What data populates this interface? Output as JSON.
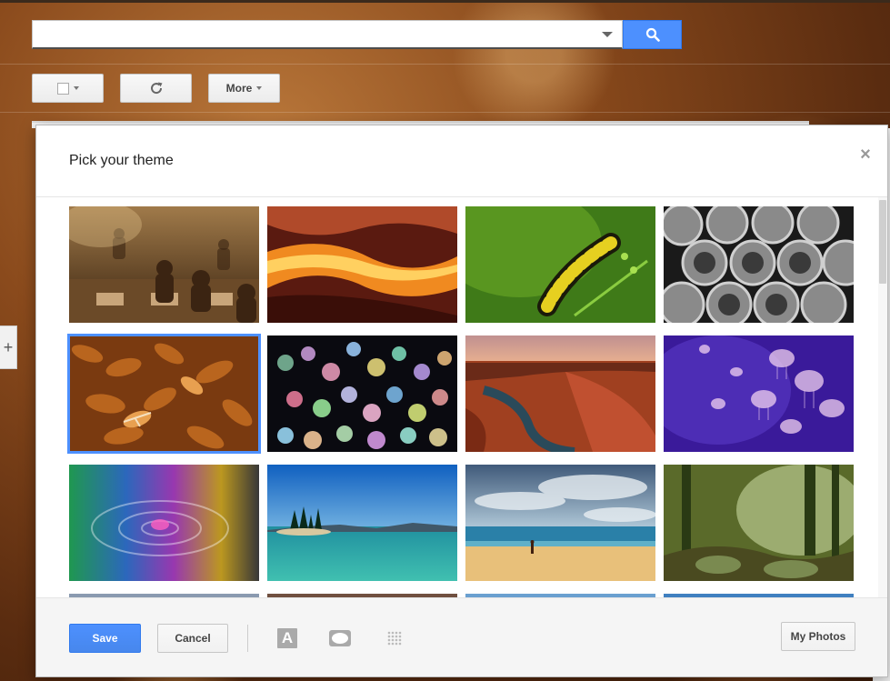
{
  "search": {
    "value": "",
    "placeholder": ""
  },
  "toolbar": {
    "more_label": "More"
  },
  "dialog": {
    "title": "Pick your theme",
    "close_glyph": "×",
    "selected_index": 4,
    "themes": [
      {
        "name": "chess"
      },
      {
        "name": "canyon"
      },
      {
        "name": "caterpillar"
      },
      {
        "name": "pipes"
      },
      {
        "name": "leaves"
      },
      {
        "name": "bokeh"
      },
      {
        "name": "horseshoe-bend"
      },
      {
        "name": "jellyfish"
      },
      {
        "name": "rainbow-water"
      },
      {
        "name": "lake"
      },
      {
        "name": "beach"
      },
      {
        "name": "forest"
      },
      {
        "name": "row4-a"
      },
      {
        "name": "row4-b"
      },
      {
        "name": "row4-c"
      },
      {
        "name": "row4-d"
      }
    ],
    "footer": {
      "save_label": "Save",
      "cancel_label": "Cancel",
      "my_photos_label": "My Photos",
      "text_color_glyph": "A"
    }
  },
  "icons": [
    "search-icon",
    "refresh-icon",
    "close-icon",
    "text-color-icon",
    "vignette-icon",
    "blur-icon"
  ],
  "colors": {
    "accent": "#4d90fe",
    "selection": "#4d90fe"
  }
}
